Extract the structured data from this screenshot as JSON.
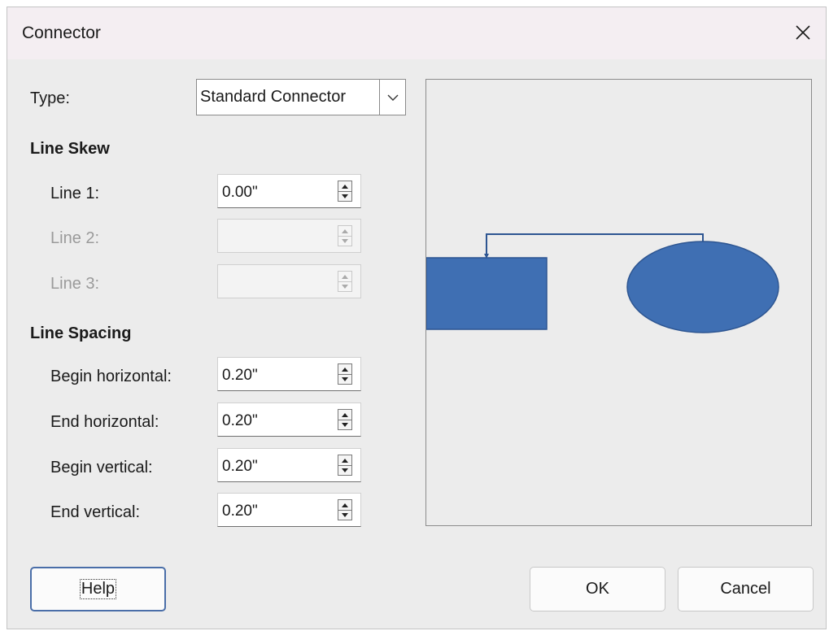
{
  "dialog": {
    "title": "Connector"
  },
  "type_row": {
    "label": "Type:",
    "selected": "Standard Connector"
  },
  "line_skew": {
    "heading": "Line Skew",
    "fields": [
      {
        "label": "Line 1:",
        "value": "0.00\"",
        "enabled": true
      },
      {
        "label": "Line 2:",
        "value": "",
        "enabled": false
      },
      {
        "label": "Line 3:",
        "value": "",
        "enabled": false
      }
    ]
  },
  "line_spacing": {
    "heading": "Line Spacing",
    "fields": [
      {
        "label": "Begin horizontal:",
        "value": "0.20\""
      },
      {
        "label": "End horizontal:",
        "value": "0.20\""
      },
      {
        "label": "Begin vertical:",
        "value": "0.20\""
      },
      {
        "label": "End vertical:",
        "value": "0.20\""
      }
    ]
  },
  "buttons": {
    "help": "Help",
    "ok": "OK",
    "cancel": "Cancel"
  },
  "colors": {
    "shape_fill": "#3f6fb3",
    "shape_stroke": "#2d5591",
    "connector": "#2d5591"
  },
  "icons": {
    "close": "close-icon",
    "dropdown": "chevron-down-icon",
    "spin_up": "spin-up-icon",
    "spin_down": "spin-down-icon"
  }
}
